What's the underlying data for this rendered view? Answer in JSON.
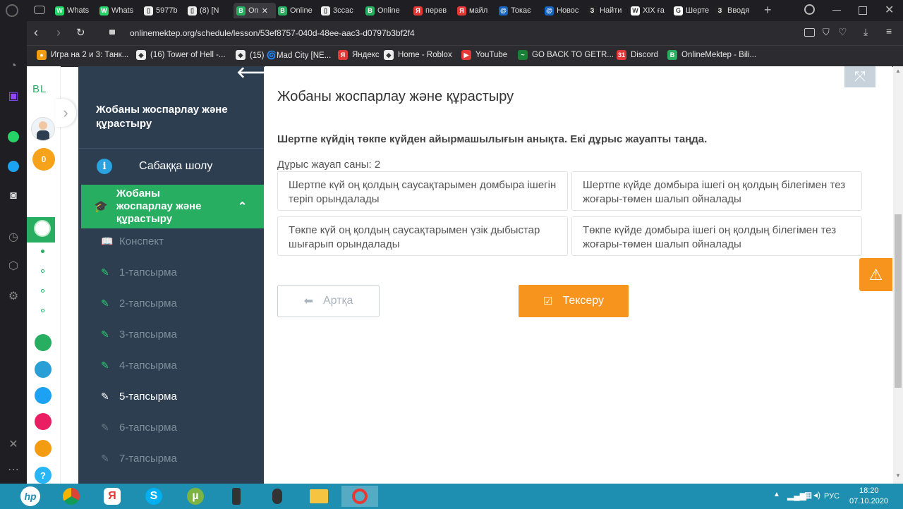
{
  "browser": {
    "tabs": [
      {
        "label": "Whats",
        "color": "#25d366",
        "glyph": "W"
      },
      {
        "label": "Whats",
        "color": "#25d366",
        "glyph": "W"
      },
      {
        "label": "5977b",
        "color": "#eeeeee",
        "glyph": "▯"
      },
      {
        "label": "(8) [N",
        "color": "#eeeeee",
        "glyph": "▯"
      },
      {
        "label": "On",
        "color": "#27ae60",
        "glyph": "B",
        "active": true
      },
      {
        "label": "Online",
        "color": "#27ae60",
        "glyph": "B"
      },
      {
        "label": "3ссас",
        "color": "#eeeeee",
        "glyph": "▯"
      },
      {
        "label": "Online",
        "color": "#27ae60",
        "glyph": "B"
      },
      {
        "label": "перев",
        "color": "#e53935",
        "glyph": "Я"
      },
      {
        "label": "майл",
        "color": "#e53935",
        "glyph": "Я"
      },
      {
        "label": "Токає",
        "color": "#1565c0",
        "glyph": "@"
      },
      {
        "label": "Новос",
        "color": "#1565c0",
        "glyph": "@"
      },
      {
        "label": "Найти",
        "color": "#222222",
        "glyph": "З"
      },
      {
        "label": "XIX ға",
        "color": "#ffffff",
        "glyph": "W"
      },
      {
        "label": "Шерте",
        "color": "#ffffff",
        "glyph": "G"
      },
      {
        "label": "Вводя",
        "color": "#222222",
        "glyph": "З"
      }
    ],
    "new_tab": "+",
    "url": "onlinemektep.org/schedule/lesson/53ef8757-040d-48ee-aac3-d0797b3bf2f4",
    "bookmarks": [
      {
        "label": "Игра на 2 и 3: Танк...",
        "color": "#f39c12",
        "glyph": "●"
      },
      {
        "label": "(16) Tower of Hell -...",
        "color": "#eeeeee",
        "glyph": "◆"
      },
      {
        "label": "(15) 🌀Mad City [NE...",
        "color": "#eeeeee",
        "glyph": "◆"
      },
      {
        "label": "Яндекс",
        "color": "#e53935",
        "glyph": "Я"
      },
      {
        "label": "Home - Roblox",
        "color": "#eeeeee",
        "glyph": "◆"
      },
      {
        "label": "YouTube",
        "color": "#e53935",
        "glyph": "▶"
      },
      {
        "label": "GO BACK TO GETR...",
        "color": "#1a7f37",
        "glyph": "~"
      },
      {
        "label": "Discord",
        "color": "#e53935",
        "glyph": "31"
      },
      {
        "label": "OnlineMektep - Bili...",
        "color": "#27ae60",
        "glyph": "B"
      }
    ]
  },
  "site": {
    "logo": "BL",
    "coins": "0",
    "help": "?"
  },
  "nav": {
    "title": "Жобаны жоспарлау және құрастыру",
    "overview_label": "Сабаққа шолу",
    "section_label": "Жобаны жоспарлау және құрастыру",
    "items": [
      {
        "label": "Конспект",
        "icon": "📖"
      },
      {
        "label": "1-тапсырма",
        "icon": "✎"
      },
      {
        "label": "2-тапсырма",
        "icon": "✎"
      },
      {
        "label": "3-тапсырма",
        "icon": "✎"
      },
      {
        "label": "4-тапсырма",
        "icon": "✎"
      },
      {
        "label": "5-тапсырма",
        "icon": "✎"
      },
      {
        "label": "6-тапсырма",
        "icon": "✎"
      },
      {
        "label": "7-тапсырма",
        "icon": "✎"
      }
    ],
    "current_index": 5
  },
  "main": {
    "page_title": "Жобаны жоспарлау және құрастыру",
    "question": "Шертпе күйдің төкпе күйден айырмашылығын анықта. Екі дұрыс жауапты таңда.",
    "correct_count": "Дұрыс жауап саны: 2",
    "answers": [
      "Шертпе күй оң қолдың саусақтарымен домбыра ішегін теріп орындалады",
      "Шертпе күйде домбыра ішегі оң қолдың білегімен тез жоғары-төмен шалып ойналады",
      "Төкпе күй оң қолдың саусақтарымен үзік дыбыстар шығарып орындалады",
      "Төкпе күйде домбыра ішегі оң қолдың білегімен тез жоғары-төмен шалып ойналады"
    ],
    "back_label": "Артқа",
    "check_label": "Тексеру"
  },
  "taskbar": {
    "lang": "РУС",
    "time": "18:20",
    "date": "07.10.2020"
  },
  "colors": {
    "green": "#27ae60",
    "nav_bg": "#2c3e50",
    "orange": "#f7941d",
    "taskbar": "#1e8fb0"
  }
}
